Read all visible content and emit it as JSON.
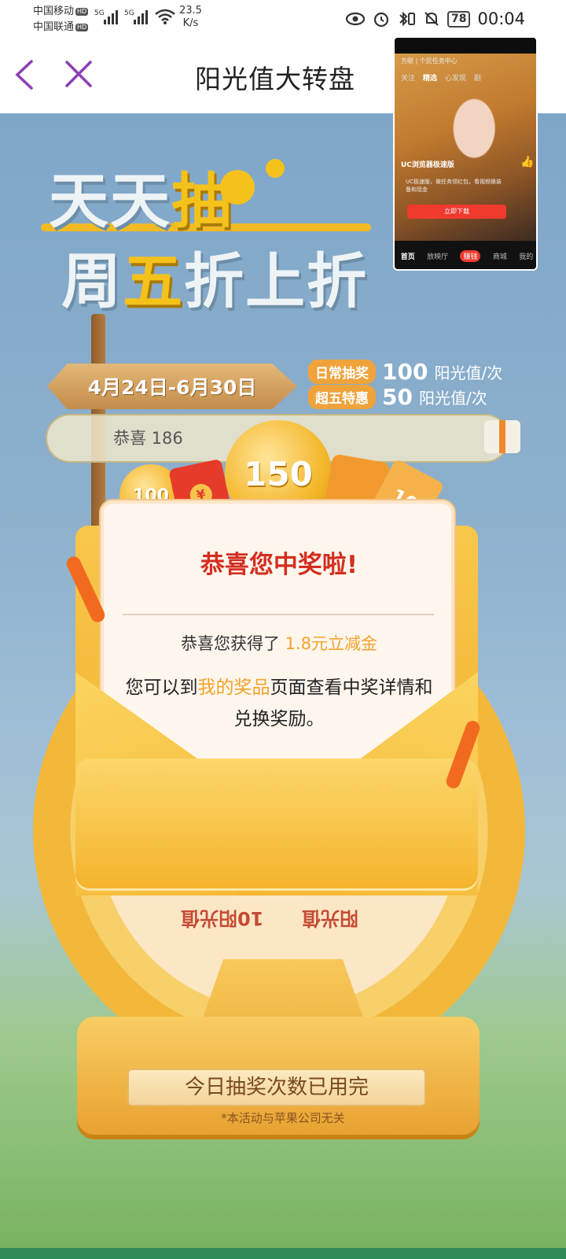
{
  "status_bar": {
    "carrier1": "中国移动",
    "carrier2": "中国联通",
    "hd_badge": "HD",
    "net_type": "5G",
    "net_speed_value": "23.5",
    "net_speed_unit": "K/s",
    "battery": "78",
    "time": "00:04"
  },
  "header": {
    "title": "阳光值大转盘"
  },
  "hero": {
    "line1_a": "天天",
    "line1_b": "抽",
    "line2_a": "周",
    "line2_b": "五",
    "line2_c": "折上折"
  },
  "sign": {
    "dates": "4月24日-6月30日"
  },
  "rules": [
    {
      "tag": "日常抽奖",
      "amount": "100",
      "unit": "阳光值/次"
    },
    {
      "tag": "超五特惠",
      "amount": "50",
      "unit": "阳光值/次"
    }
  ],
  "marquee": {
    "text": "恭喜 186"
  },
  "prizes": {
    "coin_large": "150",
    "coin_small": "100",
    "ticket": "10",
    "red_packet_symbol": "¥"
  },
  "modal": {
    "title": "恭喜您中奖啦!",
    "line1_prefix": "恭喜您获得了 ",
    "line1_amount": "1.8元立减金",
    "body_prefix": "您可以到",
    "body_link": "我的奖品",
    "body_suffix": "页面查看中奖详情和兑换奖励。"
  },
  "wheel": {
    "segment_left": "10阳光值",
    "segment_right": "阳光值"
  },
  "footer": {
    "status_button": "今日抽奖次数已用完",
    "disclaimer": "*本活动与苹果公司无关"
  },
  "pip": {
    "search": "方眼 | 个民任务中心",
    "tabs": [
      "关注",
      "精选",
      "心发现",
      "剧"
    ],
    "active_tab": "精选",
    "caption": "UC浏览器极速版",
    "tip": "UC极速版，做任务领红包，看视频换装备和现金",
    "download_button": "立即下载",
    "like_label": "点赞",
    "nav": [
      "首页",
      "放映厅",
      "赚钱",
      "商城",
      "我的"
    ]
  },
  "colors": {
    "title_red": "#d42e1f",
    "accent_gold": "#f3a329",
    "header_icon_purple": "#8a3fb5"
  }
}
